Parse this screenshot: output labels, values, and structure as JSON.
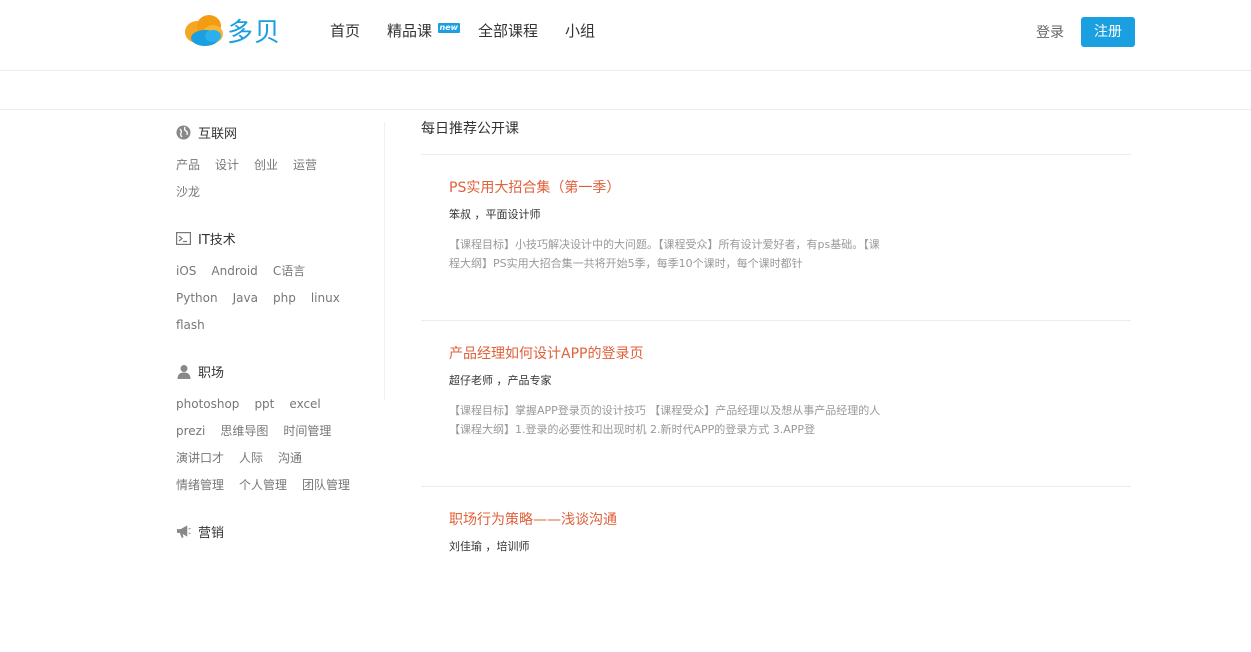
{
  "header": {
    "logo_text": "多贝",
    "nav": [
      {
        "label": "首页"
      },
      {
        "label": "精品课",
        "badge": "new"
      },
      {
        "label": "全部课程"
      },
      {
        "label": "小组"
      }
    ],
    "login": "登录",
    "register": "注册"
  },
  "sidebar": {
    "categories": [
      {
        "name": "互联网",
        "icon": "globe-icon",
        "tags": [
          "产品",
          "设计",
          "创业",
          "运营",
          "沙龙"
        ]
      },
      {
        "name": "IT技术",
        "icon": "terminal-icon",
        "tags": [
          "iOS",
          "Android",
          "C语言",
          "Python",
          "Java",
          "php",
          "linux",
          "flash"
        ]
      },
      {
        "name": "职场",
        "icon": "user-icon",
        "tags": [
          "photoshop",
          "ppt",
          "excel",
          "prezi",
          "思维导图",
          "时间管理",
          "演讲口才",
          "人际",
          "沟通",
          "情绪管理",
          "个人管理",
          "团队管理"
        ]
      },
      {
        "name": "营销",
        "icon": "megaphone-icon",
        "tags": []
      }
    ]
  },
  "main": {
    "title": "每日推荐公开课",
    "courses": [
      {
        "title": "PS实用大招合集（第一季）",
        "teacher": "笨叔 ，平面设计师",
        "desc": "【课程目标】小技巧解决设计中的大问题。【课程受众】所有设计爱好者，有ps基础。【课程大纲】PS实用大招合集一共将开始5季，每季10个课时，每个课时都针"
      },
      {
        "title": "产品经理如何设计APP的登录页",
        "teacher": "超仔老师 ，产品专家",
        "desc": "【课程目标】掌握APP登录页的设计技巧 【课程受众】产品经理以及想从事产品经理的人 【课程大纲】1.登录的必要性和出现时机 2.新时代APP的登录方式 3.APP登"
      },
      {
        "title": "职场行为策略——浅谈沟通",
        "teacher": "刘佳瑜 ，培训师",
        "desc": ""
      }
    ]
  },
  "colors": {
    "accent": "#1a9fe0",
    "course_title": "#e0603a",
    "logo_orange": "#f5a623"
  }
}
